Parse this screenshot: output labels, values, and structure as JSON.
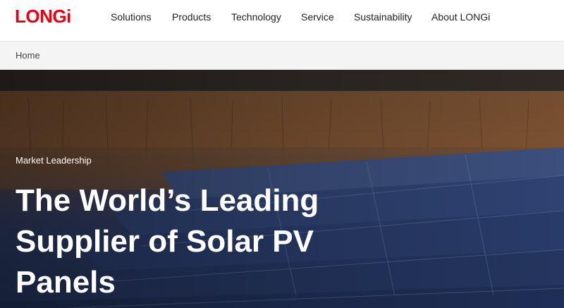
{
  "brand": {
    "logo_text": "LONGi",
    "color": "#e60012"
  },
  "nav": {
    "items": [
      {
        "label": "Solutions"
      },
      {
        "label": "Products"
      },
      {
        "label": "Technology"
      },
      {
        "label": "Service"
      },
      {
        "label": "Sustainability"
      },
      {
        "label": "About LONGi"
      }
    ]
  },
  "breadcrumb": {
    "home": "Home"
  },
  "hero": {
    "eyebrow": "Market Leadership",
    "headline": "The World’s Leading Supplier of Solar PV Panels",
    "image": "solar-panel-field-photo"
  }
}
